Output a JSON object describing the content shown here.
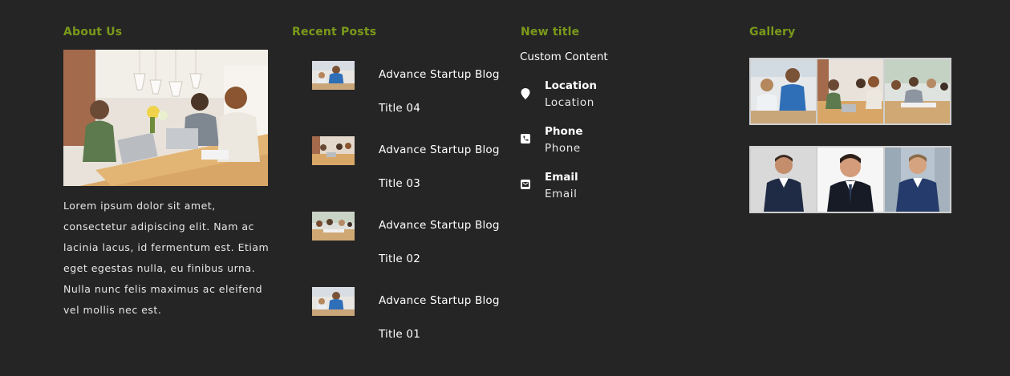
{
  "about": {
    "heading": "About Us",
    "text": "Lorem ipsum dolor sit amet, consectetur adipiscing elit. Nam ac lacinia lacus, id fermentum est. Etiam eget egestas nulla, eu finibus urna. Nulla nunc felis maximus ac eleifend vel mollis nec est."
  },
  "recent_posts": {
    "heading": "Recent Posts",
    "items": [
      {
        "title": "Advance Startup Blog Title 04"
      },
      {
        "title": "Advance Startup Blog Title 03"
      },
      {
        "title": "Advance Startup Blog Title 02"
      },
      {
        "title": "Advance Startup Blog Title 01"
      }
    ]
  },
  "new_title": {
    "heading": "New title",
    "custom": "Custom Content",
    "contacts": [
      {
        "label": "Location",
        "value": "Location",
        "icon": "map-pin-icon"
      },
      {
        "label": "Phone",
        "value": "Phone",
        "icon": "phone-icon"
      },
      {
        "label": "Email",
        "value": "Email",
        "icon": "envelope-icon"
      }
    ]
  },
  "gallery": {
    "heading": "Gallery"
  },
  "colors": {
    "background": "#252525",
    "heading_accent": "#7a9a1a",
    "text": "#ffffff"
  }
}
